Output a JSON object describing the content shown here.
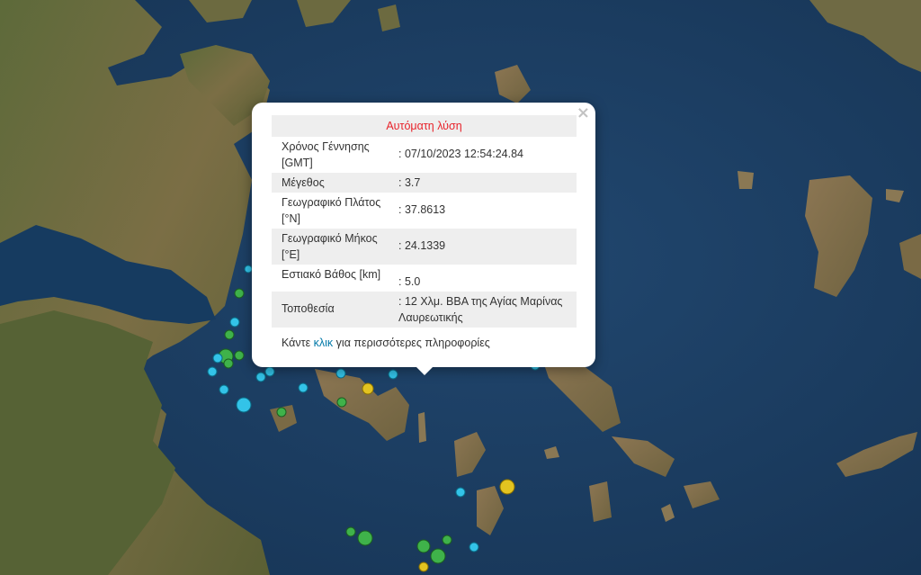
{
  "popup": {
    "header": "Αυτόματη λύση",
    "close_icon": "×",
    "rows": [
      {
        "label": "Χρόνος Γέννησης [GMT]",
        "value": ": 07/10/2023 12:54:24.84"
      },
      {
        "label": "Μέγεθος",
        "value": ": 3.7"
      },
      {
        "label": "Γεωγραφικό Πλάτος [°N]",
        "value": ": 37.8613"
      },
      {
        "label": "Γεωγραφικό Μήκος [°E]",
        "value": ": 24.1339"
      },
      {
        "label": "Εστιακό Βάθος [km]",
        "value": ": 5.0"
      },
      {
        "label": "Τοποθεσία",
        "value": ": 12 Χλμ. ΒΒΑ της Αγίας Μαρίνας Λαυρεωτικής"
      }
    ],
    "more_prefix": "Κάντε",
    "more_link": "κλικ",
    "more_suffix": "για περισσότερες πληροφορίες"
  },
  "colors": {
    "sea": "#1b3f66",
    "land": "#6b6a3c",
    "marker_cyan": "#33c3e8",
    "marker_green": "#3fb24a",
    "marker_yellow": "#e3c320",
    "header_text": "#e8222a",
    "link": "#0078a8"
  }
}
